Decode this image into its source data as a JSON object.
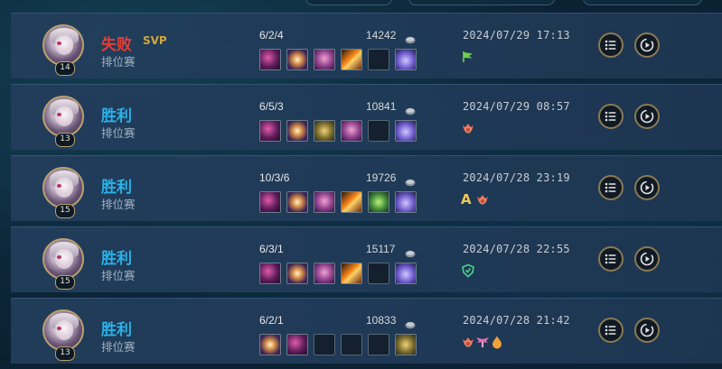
{
  "colors": {
    "win": "#2ab2e8",
    "loss": "#e33e36",
    "svp": "#d4a53a",
    "row_bg": "#233e5c",
    "button_border": "#8a7a55"
  },
  "matches": [
    {
      "level": "14",
      "result": "失败",
      "result_type": "loss",
      "svp": "SVP",
      "mode": "排位赛",
      "kda": "6/2/4",
      "gold": "14242",
      "date": "2024/07/29 17:13",
      "items": [
        "item-purple-claws",
        "item-star-burst",
        "item-pink-mask",
        "item-fire-sword",
        "empty",
        "item-purple-boots"
      ],
      "badges": [
        {
          "type": "icon",
          "name": "flag-icon"
        }
      ]
    },
    {
      "level": "13",
      "result": "胜利",
      "result_type": "win",
      "svp": "",
      "mode": "排位赛",
      "kda": "6/5/3",
      "gold": "10841",
      "date": "2024/07/29 08:57",
      "items": [
        "item-purple-claws",
        "item-star-burst",
        "item-gold-emblem",
        "item-pink-mask",
        "empty",
        "item-purple-boots"
      ],
      "badges": [
        {
          "type": "icon",
          "name": "crest-icon"
        }
      ]
    },
    {
      "level": "15",
      "result": "胜利",
      "result_type": "win",
      "svp": "",
      "mode": "排位赛",
      "kda": "10/3/6",
      "gold": "19726",
      "date": "2024/07/28 23:19",
      "items": [
        "item-purple-claws",
        "item-star-burst",
        "item-pink-mask",
        "item-fire-sword",
        "item-green-blade",
        "item-purple-boots"
      ],
      "badges": [
        {
          "type": "text",
          "text": "A"
        },
        {
          "type": "icon",
          "name": "crest-icon"
        }
      ]
    },
    {
      "level": "15",
      "result": "胜利",
      "result_type": "win",
      "svp": "",
      "mode": "排位赛",
      "kda": "6/3/1",
      "gold": "15117",
      "date": "2024/07/28 22:55",
      "items": [
        "item-purple-claws",
        "item-star-burst",
        "item-pink-mask",
        "item-fire-sword",
        "empty",
        "item-purple-boots"
      ],
      "badges": [
        {
          "type": "icon",
          "name": "shield-icon"
        }
      ]
    },
    {
      "level": "13",
      "result": "胜利",
      "result_type": "win",
      "svp": "",
      "mode": "排位赛",
      "kda": "6/2/1",
      "gold": "10833",
      "date": "2024/07/28 21:42",
      "items": [
        "item-star-burst",
        "item-purple-claws",
        "empty",
        "empty",
        "empty",
        "item-gold-emblem"
      ],
      "badges": [
        {
          "type": "icon",
          "name": "crest-icon"
        },
        {
          "type": "icon",
          "name": "wings-icon"
        },
        {
          "type": "icon",
          "name": "drop-icon"
        }
      ]
    }
  ]
}
